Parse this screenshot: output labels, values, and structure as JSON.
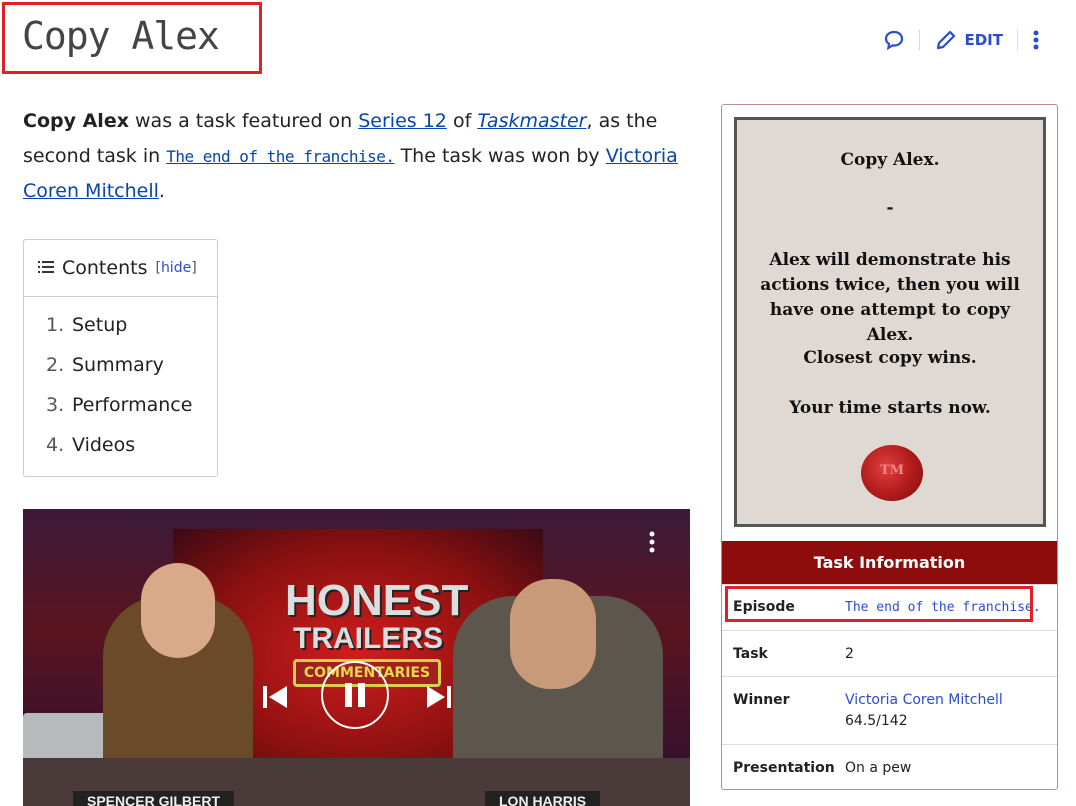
{
  "title": "Copy Alex",
  "actions": {
    "edit_label": "EDIT",
    "talk_icon": "speech-bubble-icon",
    "edit_icon": "pencil-icon",
    "more_icon": "kebab-menu-icon"
  },
  "intro": {
    "bold": "Copy Alex",
    "t1": " was a task featured on ",
    "series_link": "Series 12",
    "t2": " of ",
    "show_link": "Taskmaster",
    "t3": ", as the second task in ",
    "episode_link": "The end of the franchise.",
    "t4": " The task was won by ",
    "winner_link": "Victoria Coren Mitchell",
    "t5": "."
  },
  "toc": {
    "label": "Contents",
    "hide": "hide",
    "items": [
      {
        "num": "1.",
        "label": "Setup"
      },
      {
        "num": "2.",
        "label": "Summary"
      },
      {
        "num": "3.",
        "label": "Performance"
      },
      {
        "num": "4.",
        "label": "Videos"
      }
    ]
  },
  "video": {
    "honest": "HONEST",
    "trailers": "TRAILERS",
    "commentaries": "COMMENTARIES",
    "name_left": "SPENCER GILBERT",
    "name_right": "LON HARRIS"
  },
  "task_card": {
    "line1": "Copy Alex.",
    "line2": "-",
    "line3": "Alex will demonstrate his actions twice, then you will have one attempt to copy Alex.",
    "line4": "Closest copy wins.",
    "line5": "Your time starts now.",
    "seal": "TM"
  },
  "infobox": {
    "header": "Task Information",
    "episode_key": "Episode",
    "episode_val": "The end of the franchise.",
    "task_key": "Task",
    "task_val": "2",
    "winner_key": "Winner",
    "winner_val": "Victoria Coren Mitchell",
    "winner_score": "64.5/142",
    "presentation_key": "Presentation",
    "presentation_val": "On a pew"
  },
  "colors": {
    "link": "#0645ad",
    "accent": "#2a4bd7",
    "infobox_header": "#8d0d0d",
    "highlight": "#e01f26"
  }
}
